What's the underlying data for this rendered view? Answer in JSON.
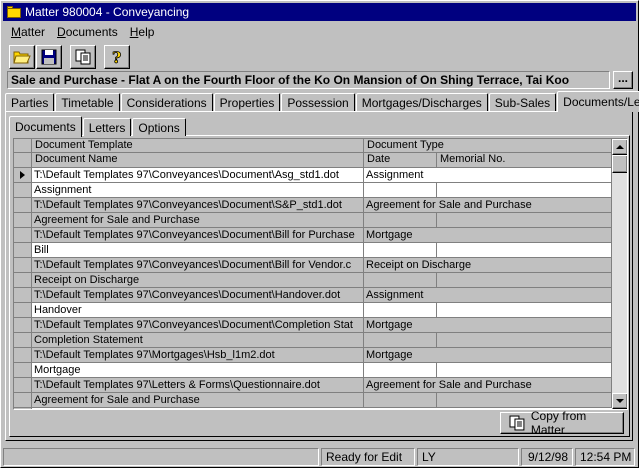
{
  "window": {
    "title": "Matter 980004 - Conveyancing"
  },
  "menu": [
    {
      "label": "Matter",
      "key": "M",
      "rest": "atter"
    },
    {
      "label": "Documents",
      "key": "D",
      "rest": "ocuments"
    },
    {
      "label": "Help",
      "key": "H",
      "rest": "elp"
    }
  ],
  "toolbar": {
    "icons": [
      "open-folder-icon",
      "save-disk-icon",
      "copy-pages-icon",
      "help-question-icon"
    ]
  },
  "matter_description": "Sale and Purchase - Flat A on the Fourth Floor of the Ko On Mansion of On Shing Terrace, Tai Koo",
  "ellipsis_label": "...",
  "main_tabs": [
    "Parties",
    "Timetable",
    "Considerations",
    "Properties",
    "Possession",
    "Mortgages/Discharges",
    "Sub-Sales",
    "Documents/Letters"
  ],
  "main_tab_active": 7,
  "sub_tabs": [
    "Documents",
    "Letters",
    "Options"
  ],
  "sub_tab_active": 0,
  "grid": {
    "headers_row1": {
      "template": "Document Template",
      "type": "Document Type"
    },
    "headers_row2": {
      "name": "Document Name",
      "date": "Date",
      "memorial": "Memorial No."
    },
    "records": [
      {
        "template": "T:\\Default Templates 97\\Conveyances\\Document\\Asg_std1.dot",
        "type": "Assignment",
        "name": "Assignment",
        "date": "",
        "memorial": "",
        "current": true
      },
      {
        "template": "T:\\Default Templates 97\\Conveyances\\Document\\S&P_std1.dot",
        "type": "Agreement for Sale and Purchase",
        "name": "Agreement for Sale and Purchase",
        "date": "",
        "memorial": "",
        "current": false
      },
      {
        "template": "T:\\Default Templates 97\\Conveyances\\Document\\Bill for Purchase",
        "type": "Mortgage",
        "name": "Bill",
        "date": "",
        "memorial": "",
        "current": false
      },
      {
        "template": "T:\\Default Templates 97\\Conveyances\\Document\\Bill for Vendor.c",
        "type": "Receipt on Discharge",
        "name": "Receipt on Discharge",
        "date": "",
        "memorial": "",
        "current": false
      },
      {
        "template": "T:\\Default Templates 97\\Conveyances\\Document\\Handover.dot",
        "type": "Assignment",
        "name": "Handover",
        "date": "",
        "memorial": "",
        "current": false
      },
      {
        "template": "T:\\Default Templates 97\\Conveyances\\Document\\Completion Stat",
        "type": "Mortgage",
        "name": "Completion Statement",
        "date": "",
        "memorial": "",
        "current": false
      },
      {
        "template": "T:\\Default Templates 97\\Mortgages\\Hsb_l1m2.dot",
        "type": "Mortgage",
        "name": "Mortgage",
        "date": "",
        "memorial": "",
        "current": false
      },
      {
        "template": "T:\\Default Templates 97\\Letters & Forms\\Questionnaire.dot",
        "type": "Agreement for Sale and Purchase",
        "name": "Agreement for Sale and Purchase",
        "date": "",
        "memorial": "",
        "current": false
      }
    ]
  },
  "copy_button": {
    "label": "Copy from Matter",
    "icon": "copy-pages-icon"
  },
  "status": {
    "mode": "Ready for Edit",
    "user": "LY",
    "date": "9/12/98",
    "time": "12:54 PM"
  }
}
